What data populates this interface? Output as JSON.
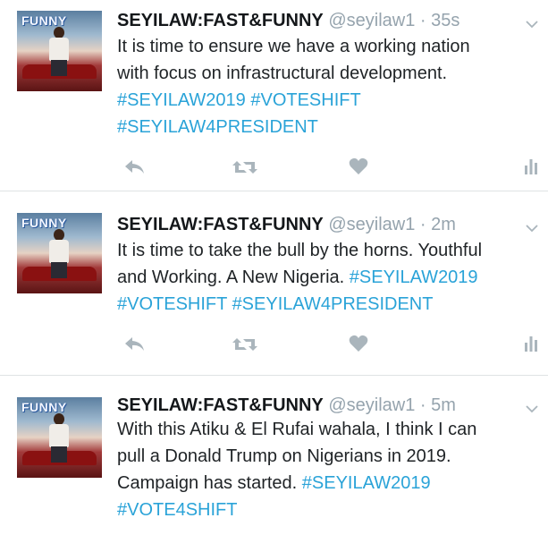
{
  "tweets": [
    {
      "avatar_text": "FUNNY",
      "name": "SEYILAW:FAST&FUNNY",
      "handle": "@seyilaw1",
      "separator": "·",
      "time": "35s",
      "lines": [
        [
          {
            "text": "It is time to ensure we have a working nation",
            "tag": false
          }
        ],
        [
          {
            "text": "with focus on infrastructural development.",
            "tag": false
          }
        ],
        [
          {
            "text": "#SEYILAW2019",
            "tag": true
          },
          {
            "text": " ",
            "tag": false
          },
          {
            "text": "#VOTESHIFT",
            "tag": true
          }
        ],
        [
          {
            "text": "#SEYILAW4PRESIDENT",
            "tag": true
          }
        ]
      ]
    },
    {
      "avatar_text": "FUNNY",
      "name": "SEYILAW:FAST&FUNNY",
      "handle": "@seyilaw1",
      "separator": "·",
      "time": "2m",
      "lines": [
        [
          {
            "text": "It is time to take the bull by the horns. Youthful",
            "tag": false
          }
        ],
        [
          {
            "text": "and Working. A New Nigeria. ",
            "tag": false
          },
          {
            "text": "#SEYILAW2019",
            "tag": true
          }
        ],
        [
          {
            "text": "#VOTESHIFT",
            "tag": true
          },
          {
            "text": " ",
            "tag": false
          },
          {
            "text": "#SEYILAW4PRESIDENT",
            "tag": true
          }
        ]
      ]
    },
    {
      "avatar_text": "FUNNY",
      "name": "SEYILAW:FAST&FUNNY",
      "handle": "@seyilaw1",
      "separator": "·",
      "time": "5m",
      "lines": [
        [
          {
            "text": "With this Atiku & El Rufai wahala, I think I can",
            "tag": false
          }
        ],
        [
          {
            "text": "pull a Donald Trump on Nigerians in 2019.",
            "tag": false
          }
        ],
        [
          {
            "text": "Campaign has started. ",
            "tag": false
          },
          {
            "text": "#SEYILAW2019",
            "tag": true
          }
        ],
        [
          {
            "text": "#VOTE4SHIFT",
            "tag": true
          }
        ]
      ]
    }
  ],
  "icons": {
    "reply": "reply-icon",
    "retweet": "retweet-icon",
    "like": "heart-icon",
    "analytics": "analytics-icon",
    "menu": "chevron-down-icon"
  },
  "colors": {
    "hashtag": "#2aa3d8",
    "muted": "#95a3ad",
    "icon": "#aab5bc",
    "divider": "#dfe3e4"
  }
}
